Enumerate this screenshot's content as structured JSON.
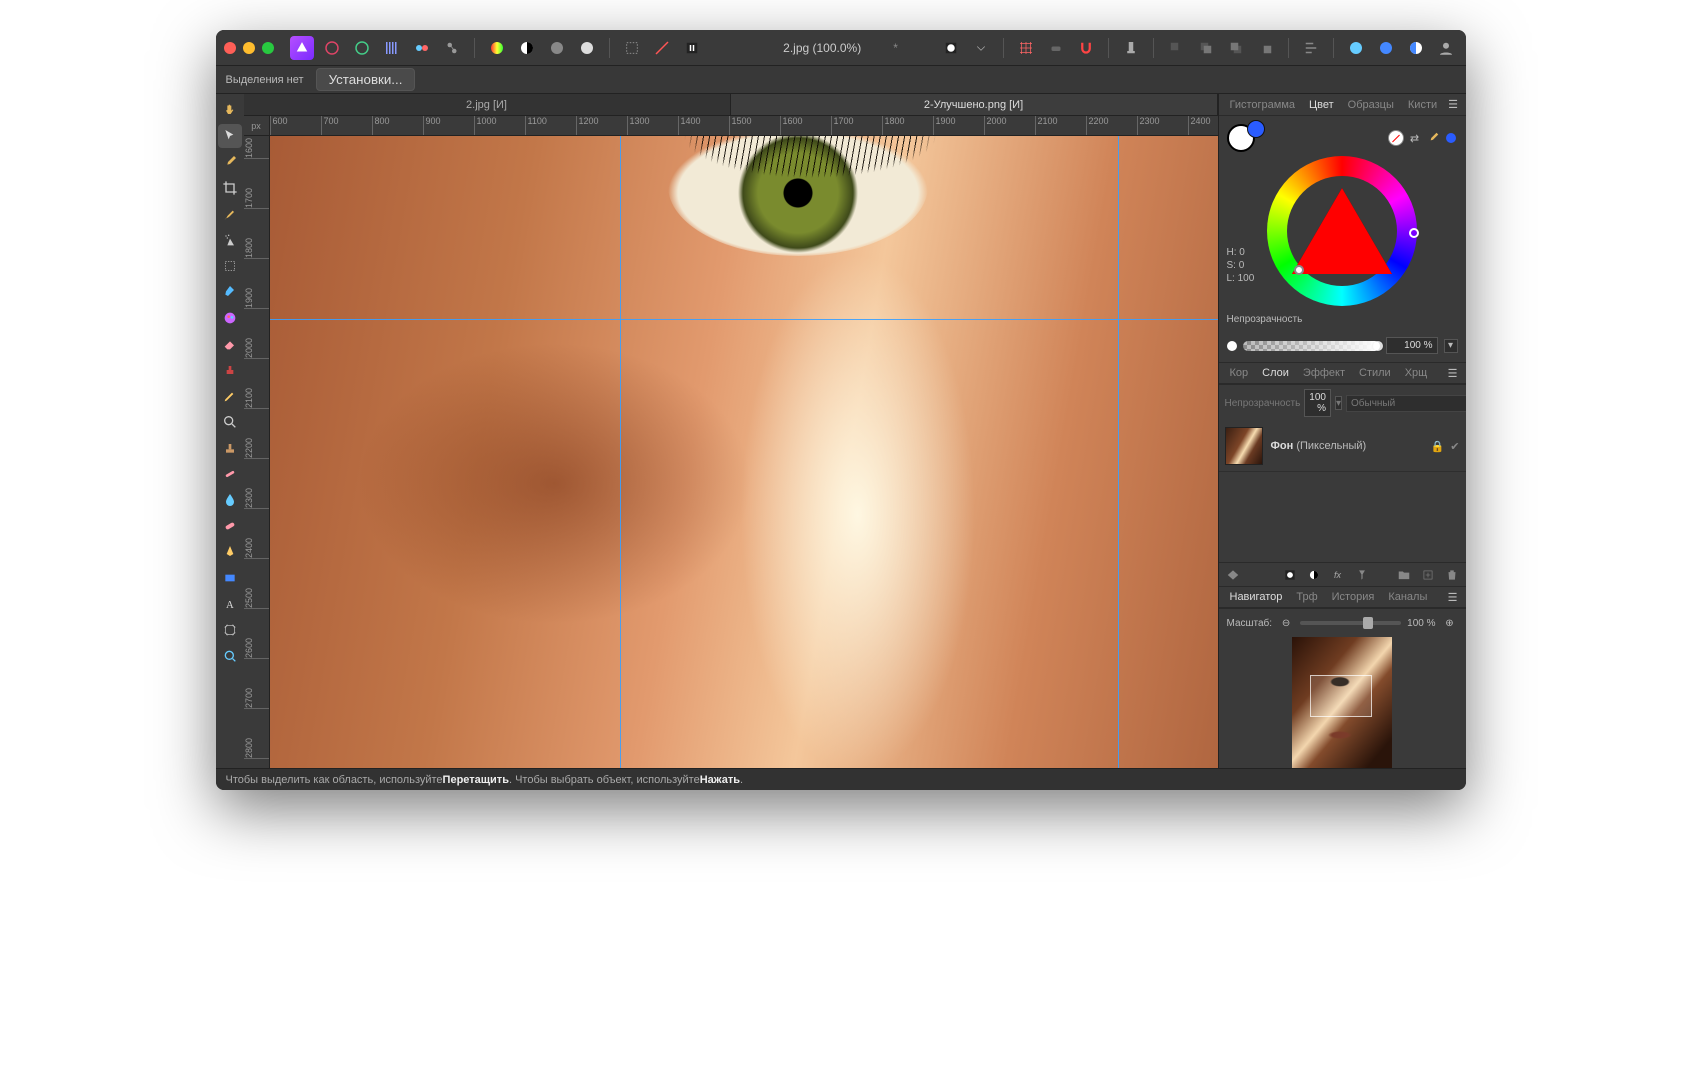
{
  "toolbar": {
    "doc_title": "2.jpg (100.0%)",
    "dirty_marker": "*"
  },
  "contextbar": {
    "selection_status": "Выделения нет",
    "presets_button": "Установки..."
  },
  "doc_tabs": [
    {
      "label": "2.jpg [И]",
      "active": false
    },
    {
      "label": "2-Улучшено.png [И]",
      "active": true
    }
  ],
  "ruler": {
    "unit": "px",
    "h_ticks": [
      "600",
      "700",
      "800",
      "900",
      "1000",
      "1100",
      "1200",
      "1300",
      "1400",
      "1500",
      "1600",
      "1700",
      "1800",
      "1900",
      "2000",
      "2100",
      "2200",
      "2300",
      "2400"
    ],
    "v_ticks": [
      "1600",
      "1700",
      "1800",
      "1900",
      "2000",
      "2100",
      "2200",
      "2300",
      "2400",
      "2500",
      "2600",
      "2700",
      "2800"
    ]
  },
  "right_panel": {
    "colour_tabs": [
      "Гистограмма",
      "Цвет",
      "Образцы",
      "Кисти"
    ],
    "colour_active": "Цвет",
    "hsl": {
      "h": "H: 0",
      "s": "S: 0",
      "l": "L: 100"
    },
    "opacity_label": "Непрозрачность",
    "opacity_value": "100 %",
    "layers_tabs": [
      "Кор",
      "Слои",
      "Эффект",
      "Стили",
      "Хрщ"
    ],
    "layers_active": "Слои",
    "layer_opacity_label": "Непрозрачность",
    "layer_opacity_value": "100 %",
    "blend_mode": "Обычный",
    "layer": {
      "name_bold": "Фон",
      "name_rest": " (Пиксельный)"
    },
    "nav_tabs": [
      "Навигатор",
      "Трф",
      "История",
      "Каналы"
    ],
    "nav_active": "Навигатор",
    "zoom_label": "Масштаб:",
    "zoom_value": "100 %"
  },
  "status": {
    "text_a": "Чтобы выделить как область, используйте ",
    "bold_a": "Перетащить",
    "text_b": ". Чтобы выбрать объект, используйте ",
    "bold_b": "Нажать",
    "tail": "."
  }
}
